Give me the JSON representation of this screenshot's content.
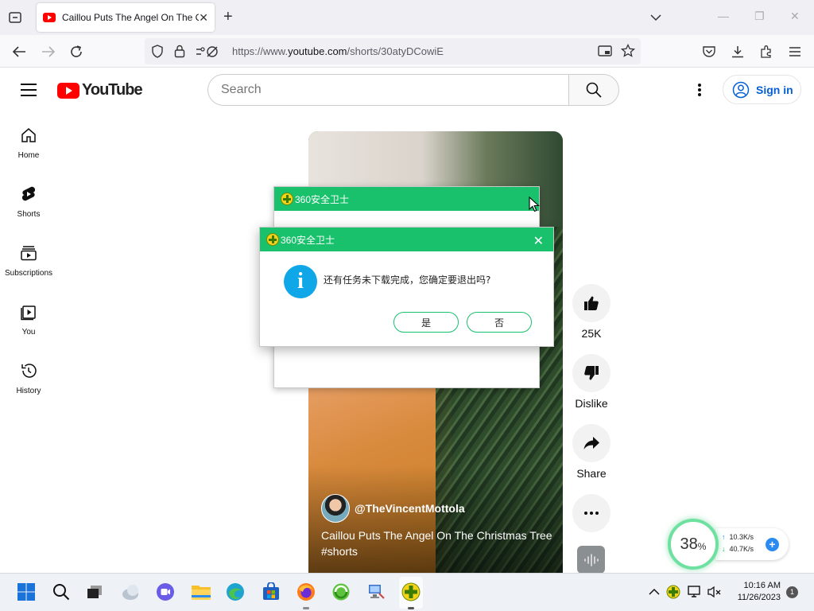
{
  "browser": {
    "tab_title": "Caillou Puts The Angel On The Christmas Tree #shorts",
    "url_prefix": "https://www.",
    "url_domain": "youtube.com",
    "url_path": "/shorts/30atyDCowiE"
  },
  "youtube": {
    "logo_text": "YouTube",
    "search_placeholder": "Search",
    "sign_in": "Sign in",
    "nav": [
      {
        "label": "Home",
        "icon": "home-icon"
      },
      {
        "label": "Shorts",
        "icon": "shorts-icon"
      },
      {
        "label": "Subscriptions",
        "icon": "subscriptions-icon"
      },
      {
        "label": "You",
        "icon": "you-icon"
      },
      {
        "label": "History",
        "icon": "history-icon"
      }
    ],
    "short": {
      "channel": "@TheVincentMottola",
      "title": "Caillou Puts The Angel On The Christmas Tree #shorts"
    },
    "actions": {
      "like_count": "25K",
      "dislike": "Dislike",
      "share": "Share"
    }
  },
  "dialog_back": {
    "title": "360安全卫士"
  },
  "dialog": {
    "title": "360安全卫士",
    "message": "还有任务未下载完成，您确定要退出吗?",
    "yes": "是",
    "no": "否"
  },
  "widget": {
    "percent": "38",
    "percent_unit": "%",
    "upload": "10.3K/s",
    "download": "40.7K/s"
  },
  "taskbar": {
    "time": "10:16 AM",
    "date": "11/26/2023",
    "notifications": "1"
  },
  "colors": {
    "youtube_red": "#ff0000",
    "dialog_green": "#1ac16d",
    "info_blue": "#0fa7e8",
    "link_blue": "#065fd4"
  }
}
